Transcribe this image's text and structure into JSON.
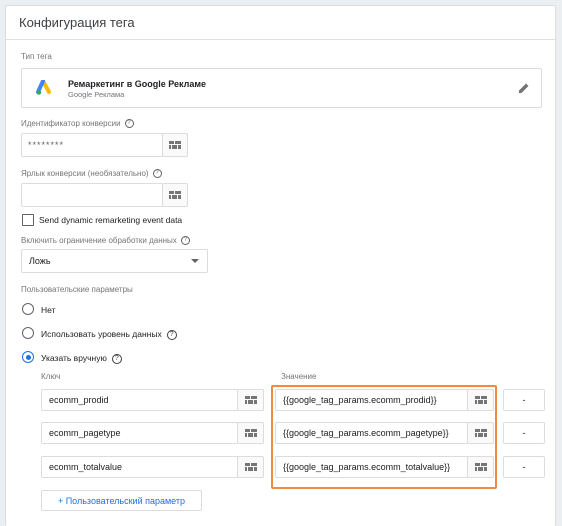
{
  "card_title": "Конфигурация тега",
  "tag_type": {
    "label": "Тип тега",
    "title": "Ремаркетинг в Google Рекламе",
    "subtitle": "Google Реклама",
    "icon": "google-ads-logo"
  },
  "conversion_id": {
    "label": "Идентификатор конверсии",
    "value": "********"
  },
  "conversion_label": {
    "label": "Ярлык конверсии (необязательно)",
    "value": ""
  },
  "send_dynamic": {
    "label": "Send dynamic remarketing event data",
    "checked": false
  },
  "data_restriction": {
    "label": "Включить ограничение обработки данных",
    "value": "Ложь"
  },
  "custom_params": {
    "label": "Пользовательские параметры",
    "options": [
      "Нет",
      "Использовать уровень данных",
      "Указать вручную"
    ],
    "selected": "Указать вручную",
    "key_header": "Ключ",
    "value_header": "Значение",
    "rows": [
      {
        "key": "ecomm_prodid",
        "value": "{{google_tag_params.ecomm_prodid}}",
        "remove": "-"
      },
      {
        "key": "ecomm_pagetype",
        "value": "{{google_tag_params.ecomm_pagetype}}",
        "remove": "-"
      },
      {
        "key": "ecomm_totalvalue",
        "value": "{{google_tag_params.ecomm_totalvalue}}",
        "remove": "-"
      }
    ],
    "add_button": "+ Пользовательский параметр"
  },
  "colors": {
    "accent": "#1a73e8",
    "highlight": "#f08a3e"
  }
}
